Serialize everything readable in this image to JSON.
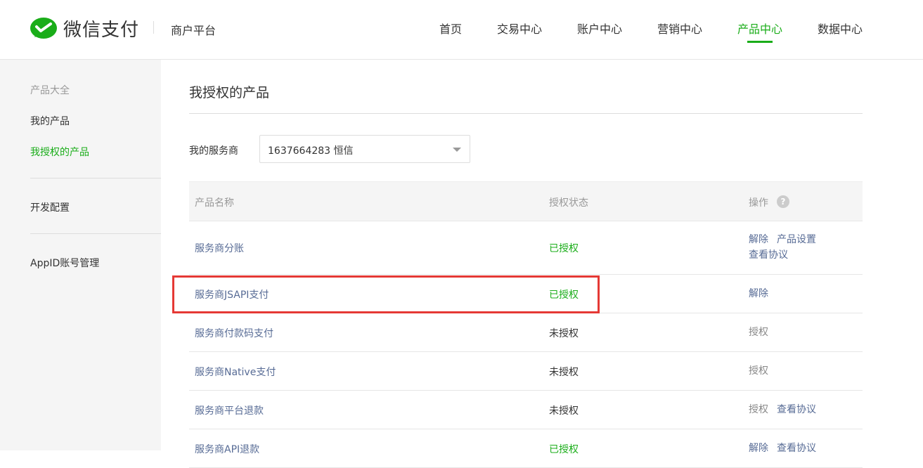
{
  "brand": {
    "name": "微信支付",
    "platform": "商户平台"
  },
  "nav": {
    "items": [
      {
        "label": "首页"
      },
      {
        "label": "交易中心"
      },
      {
        "label": "账户中心"
      },
      {
        "label": "营销中心"
      },
      {
        "label": "产品中心"
      },
      {
        "label": "数据中心"
      }
    ],
    "active": "产品中心"
  },
  "sidebar": {
    "section_title": "产品大全",
    "items": [
      {
        "label": "我的产品"
      },
      {
        "label": "我授权的产品"
      },
      {
        "label": "开发配置"
      },
      {
        "label": "AppID账号管理"
      }
    ],
    "active": "我授权的产品"
  },
  "main": {
    "title": "我授权的产品",
    "filter": {
      "label": "我的服务商",
      "selected": "1637664283 恒信"
    },
    "table": {
      "headers": [
        "产品名称",
        "授权状态",
        "操作"
      ],
      "rows": [
        {
          "name": "服务商分账",
          "status": "已授权",
          "ops": [
            "解除",
            "产品设置",
            "查看协议"
          ]
        },
        {
          "name": "服务商JSAPI支付",
          "status": "已授权",
          "ops": [
            "解除"
          ]
        },
        {
          "name": "服务商付款码支付",
          "status": "未授权",
          "ops": [
            "授权"
          ]
        },
        {
          "name": "服务商Native支付",
          "status": "未授权",
          "ops": [
            "授权"
          ]
        },
        {
          "name": "服务商平台退款",
          "status": "未授权",
          "ops": [
            "授权",
            "查看协议"
          ]
        },
        {
          "name": "服务商API退款",
          "status": "已授权",
          "ops": [
            "解除",
            "查看协议"
          ]
        }
      ]
    }
  },
  "colors": {
    "accent": "#1aad19",
    "link": "#576b95",
    "highlight": "#e53935"
  },
  "icons": {
    "logo": "wechat-pay-logo-icon",
    "help": "help-question-icon",
    "dropdown": "chevron-down-icon"
  }
}
